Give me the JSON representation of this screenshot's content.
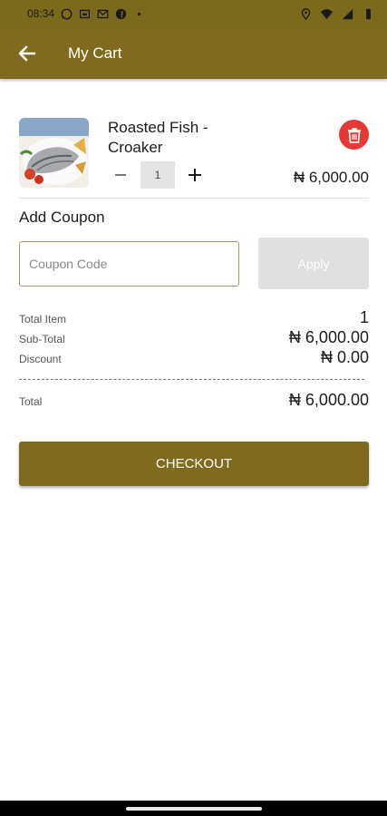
{
  "status_bar": {
    "time": "08:34",
    "left_icons": [
      "whatsapp-icon",
      "store-icon",
      "gmail-icon",
      "facebook-icon",
      "more-dot-icon"
    ],
    "right_icons": [
      "location-icon",
      "wifi-icon",
      "signal-icon",
      "battery-icon"
    ]
  },
  "app_bar": {
    "title": "My Cart",
    "back_icon": "arrow-left-icon"
  },
  "cart": {
    "items": [
      {
        "name": "Roasted Fish - Croaker",
        "quantity": "1",
        "price": "₦ 6,000.00",
        "decrease_symbol": "−",
        "increase_symbol": "+"
      }
    ]
  },
  "coupon": {
    "title": "Add Coupon",
    "placeholder": "Coupon Code",
    "apply_label": "Apply"
  },
  "summary": {
    "total_item_label": "Total Item",
    "total_item_value": "1",
    "subtotal_label": "Sub-Total",
    "subtotal_value": "₦ 6,000.00",
    "discount_label": "Discount",
    "discount_value": "₦ 0.00",
    "total_label": "Total",
    "total_value": "₦ 6,000.00"
  },
  "checkout_label": "CHECKOUT",
  "colors": {
    "primary": "#806a1f",
    "delete": "#e53935",
    "disabled": "#e0e0e0"
  }
}
